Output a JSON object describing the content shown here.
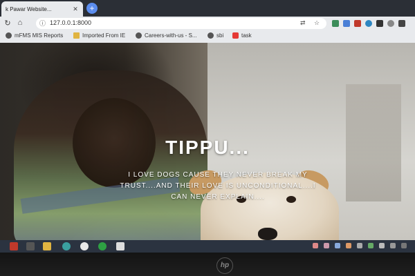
{
  "browser": {
    "tab_title": "k Pawar Website...",
    "new_tab": "+",
    "url": "127.0.0.1:8000",
    "nav": {
      "back": "←",
      "forward": "→",
      "reload": "↻",
      "home": "⌂"
    }
  },
  "bookmarks": [
    {
      "label": "mFMS MIS Reports",
      "icon": "globe-icon"
    },
    {
      "label": "Imported From IE",
      "icon": "folder-icon"
    },
    {
      "label": "Careers-with-us - S...",
      "icon": "globe-icon"
    },
    {
      "label": "sbi",
      "icon": "globe-icon"
    },
    {
      "label": "task",
      "icon": "youtube-icon"
    }
  ],
  "hero": {
    "title": "TIPPU...",
    "text": "I LOVE DOGS CAUSE THEY NEVER BREAK MY TRUST....AND THEIR LOVE IS UNCONDITIONAL....I CAN NEVER EXPLAIN...."
  },
  "carousel": {
    "slide_count": 16,
    "active_index": 0
  },
  "device": {
    "brand": "hp"
  }
}
